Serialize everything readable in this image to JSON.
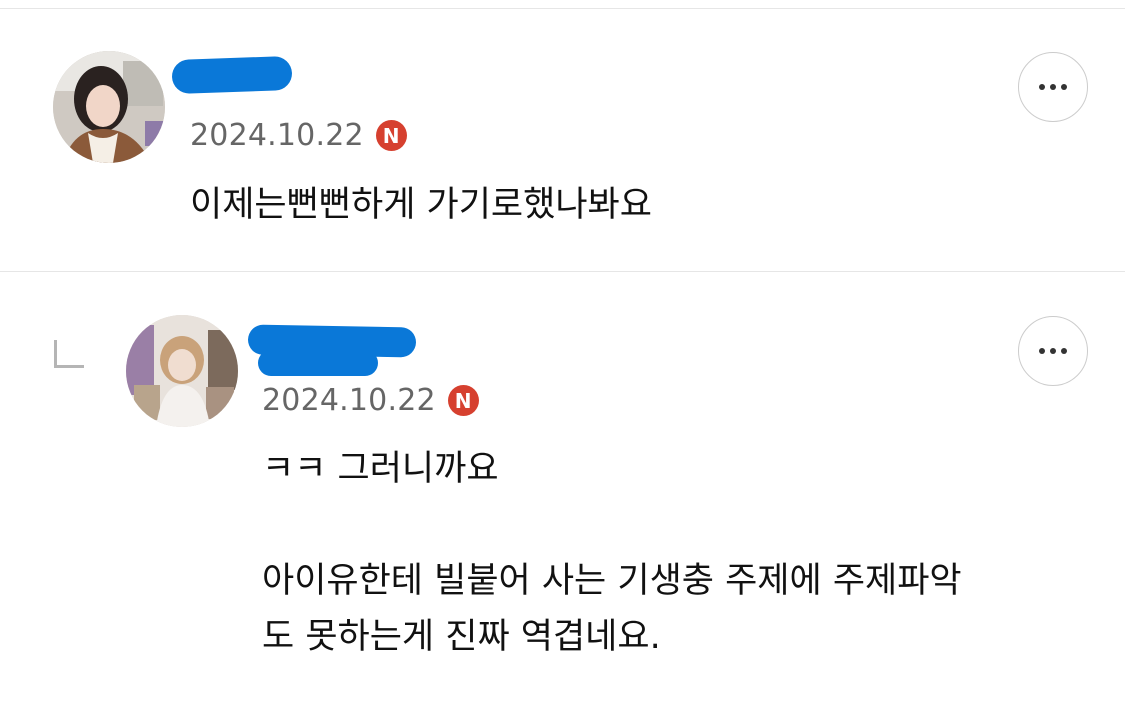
{
  "comments": [
    {
      "avatar": "user-avatar-photo",
      "author": "",
      "date": "2024.10.22",
      "badge": "N",
      "text": "이제는뻔뻔하게 가기로했나봐요",
      "more_icon": "more-horizontal-icon"
    },
    {
      "avatar": "user-avatar-photo",
      "author": "",
      "date": "2024.10.22",
      "badge": "N",
      "text": "ㅋㅋ 그러니까요\n\n아이유한테 빌붙어 사는 기생충 주제에 주제파악\n도 못하는게 진짜 역겹네요.",
      "reply_icon": "reply-arrow-icon",
      "more_icon": "more-horizontal-icon"
    }
  ],
  "colors": {
    "badge": "#d6402f",
    "redaction": "#0a78d8",
    "meta_text": "#666666",
    "divider": "#e6e6e6"
  }
}
